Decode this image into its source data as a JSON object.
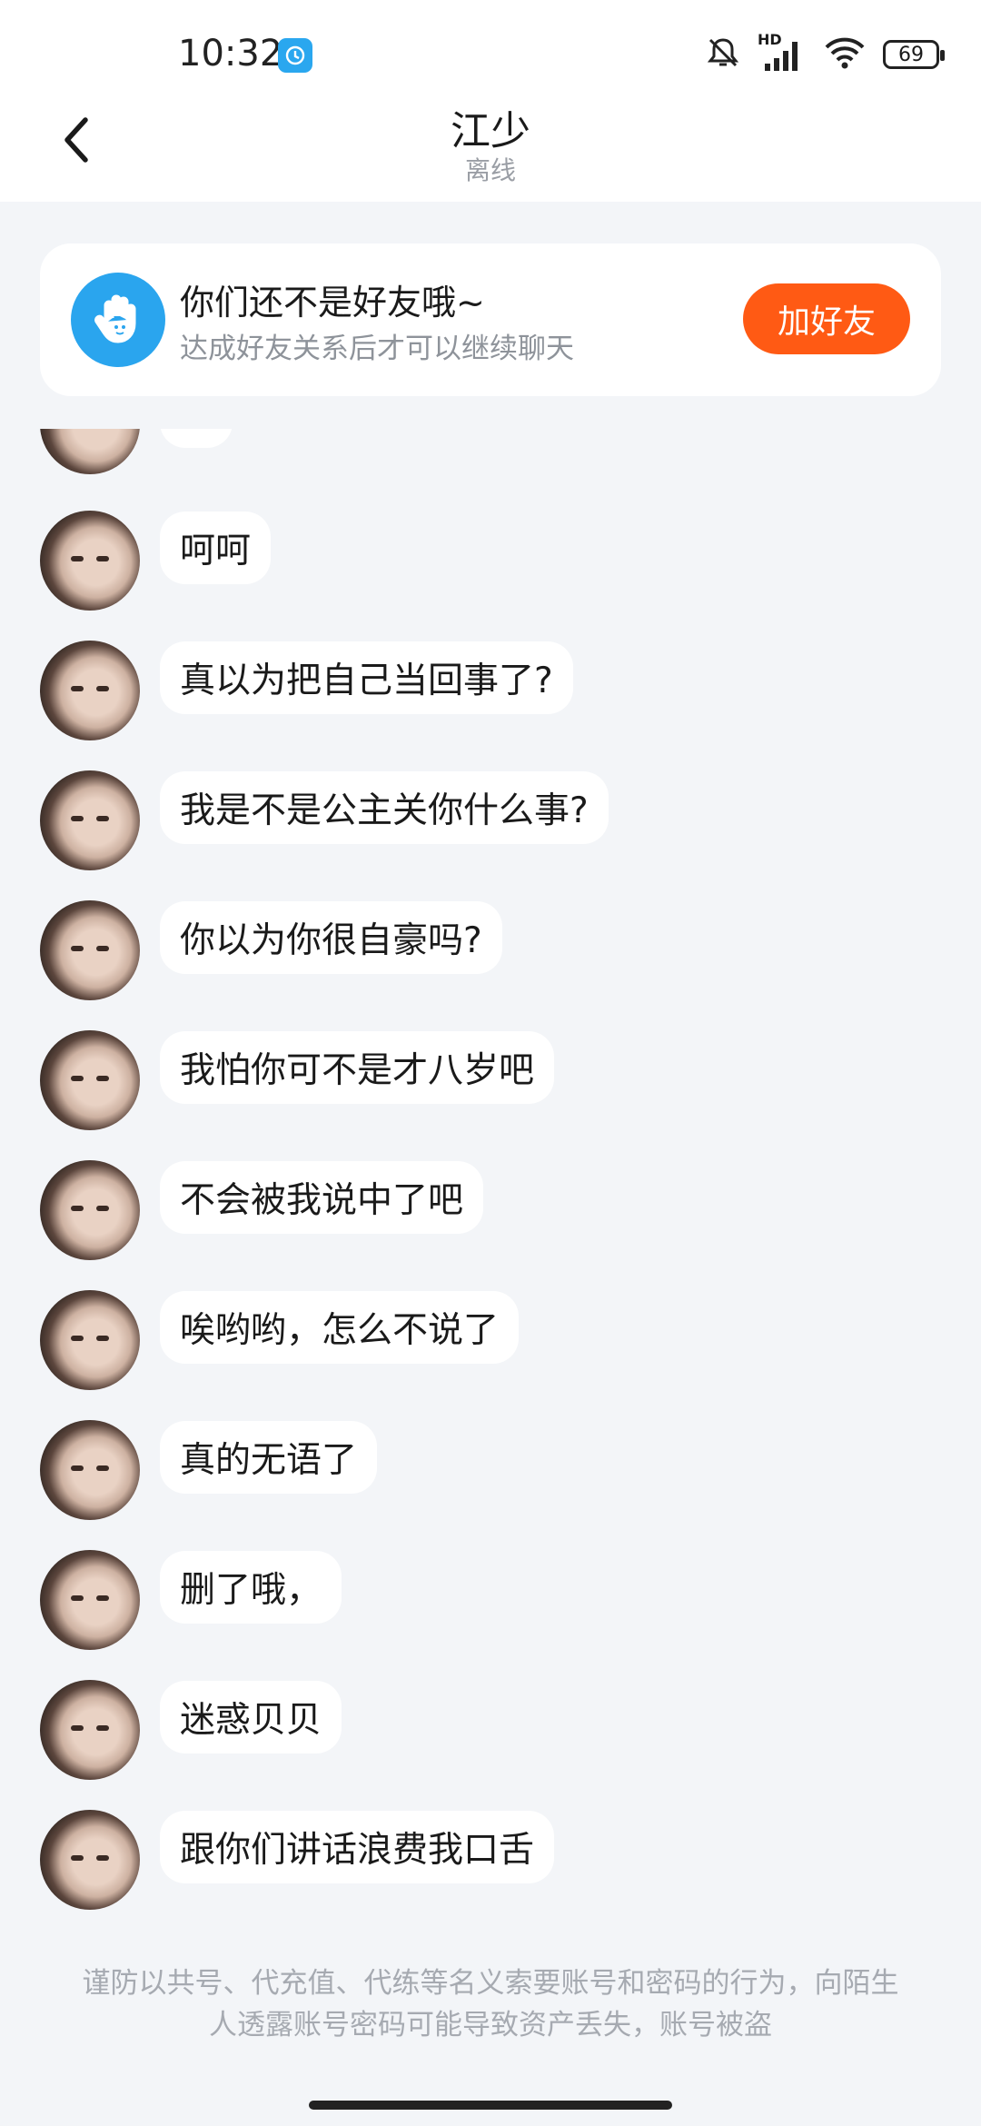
{
  "status_bar": {
    "time": "10:32",
    "hd_label": "HD",
    "battery": "69",
    "icons": [
      "app-notification-icon",
      "mute-bell-icon",
      "cell-signal-icon",
      "wifi-icon",
      "battery-icon"
    ]
  },
  "header": {
    "back_icon": "chevron-left-icon",
    "title": "江少",
    "subtitle": "离线"
  },
  "friend_banner": {
    "icon": "hand-wave-icon",
    "title": "你们还不是好友哦~",
    "subtitle": "达成好友关系后才可以继续聊天",
    "button_label": "加好友",
    "button_color": "#ff5a14"
  },
  "messages": [
    {
      "text": ""
    },
    {
      "text": "呵呵"
    },
    {
      "text": "真以为把自己当回事了?"
    },
    {
      "text": "我是不是公主关你什么事?"
    },
    {
      "text": "你以为你很自豪吗?"
    },
    {
      "text": "我怕你可不是才八岁吧"
    },
    {
      "text": "不会被我说中了吧"
    },
    {
      "text": "唉哟哟，怎么不说了"
    },
    {
      "text": "真的无语了"
    },
    {
      "text": "删了哦，"
    },
    {
      "text": "迷惑贝贝"
    },
    {
      "text": "跟你们讲话浪费我口舌"
    }
  ],
  "disclaimer": "谨防以共号、代充值、代练等名义索要账号和密码的行为，向陌生人透露账号密码可能导致资产丢失，账号被盗",
  "colors": {
    "page_bg": "#f3f5f8",
    "accent_blue": "#2aa5ee"
  }
}
